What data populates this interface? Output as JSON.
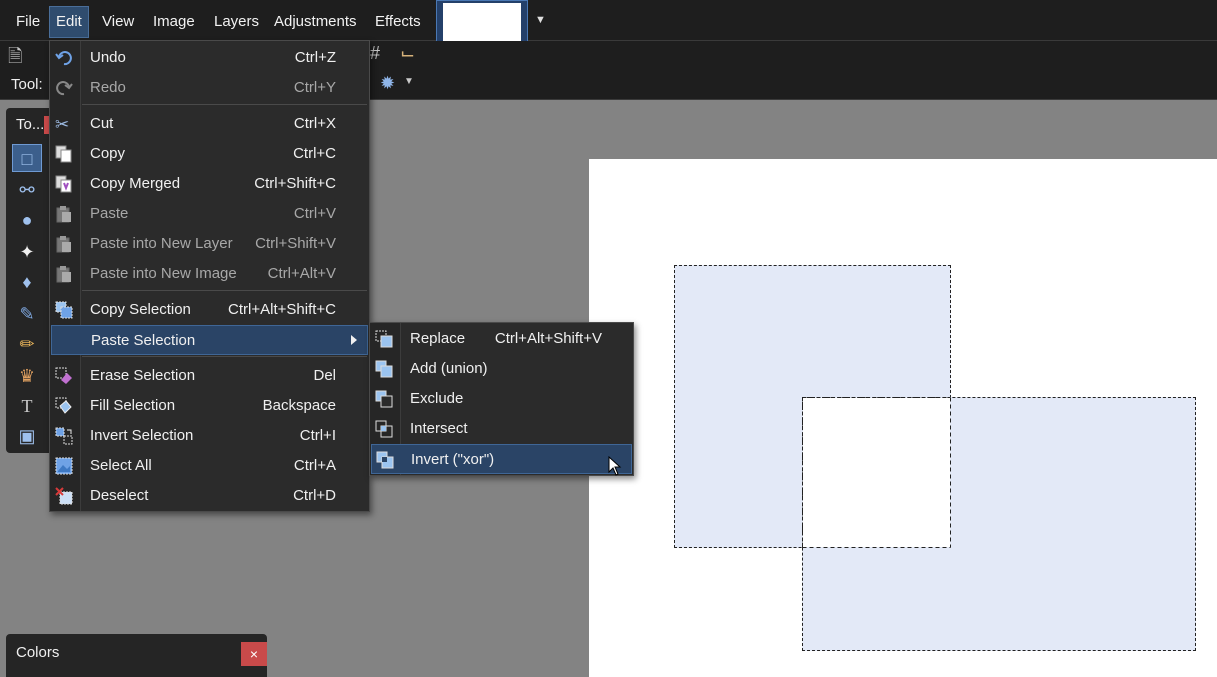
{
  "menubar": {
    "items": [
      "File",
      "Edit",
      "View",
      "Image",
      "Layers",
      "Adjustments",
      "Effects"
    ],
    "active": "Edit"
  },
  "toolbar": {
    "tool_label": "Tool:"
  },
  "tools_panel": {
    "title": "To..."
  },
  "colors_panel": {
    "title": "Colors",
    "close": "×"
  },
  "edit_menu": {
    "items": [
      {
        "label": "Undo",
        "shortcut": "Ctrl+Z",
        "icon": "undo-icon"
      },
      {
        "label": "Redo",
        "shortcut": "Ctrl+Y",
        "icon": "redo-icon"
      },
      {
        "label": "Cut",
        "shortcut": "Ctrl+X",
        "icon": "scissors-icon"
      },
      {
        "label": "Copy",
        "shortcut": "Ctrl+C",
        "icon": "copy-icon"
      },
      {
        "label": "Copy Merged",
        "shortcut": "Ctrl+Shift+C",
        "icon": "copy-merged-icon"
      },
      {
        "label": "Paste",
        "shortcut": "Ctrl+V",
        "icon": "paste-icon"
      },
      {
        "label": "Paste into New Layer",
        "shortcut": "Ctrl+Shift+V",
        "icon": "paste-layer-icon"
      },
      {
        "label": "Paste into New Image",
        "shortcut": "Ctrl+Alt+V",
        "icon": "paste-image-icon"
      },
      {
        "label": "Copy Selection",
        "shortcut": "Ctrl+Alt+Shift+C",
        "icon": "copy-selection-icon"
      },
      {
        "label": "Paste Selection",
        "shortcut": "",
        "icon": "paste-selection-icon"
      },
      {
        "label": "Erase Selection",
        "shortcut": "Del",
        "icon": "eraser-icon"
      },
      {
        "label": "Fill Selection",
        "shortcut": "Backspace",
        "icon": "fill-bucket-icon"
      },
      {
        "label": "Invert Selection",
        "shortcut": "Ctrl+I",
        "icon": "invert-selection-icon"
      },
      {
        "label": "Select All",
        "shortcut": "Ctrl+A",
        "icon": "select-all-icon"
      },
      {
        "label": "Deselect",
        "shortcut": "Ctrl+D",
        "icon": "deselect-icon"
      }
    ]
  },
  "paste_selection_submenu": {
    "items": [
      {
        "label": "Replace",
        "shortcut": "Ctrl+Alt+Shift+V",
        "icon": "replace-icon"
      },
      {
        "label": "Add (union)",
        "shortcut": "",
        "icon": "union-icon"
      },
      {
        "label": "Exclude",
        "shortcut": "",
        "icon": "exclude-icon"
      },
      {
        "label": "Intersect",
        "shortcut": "",
        "icon": "intersect-icon"
      },
      {
        "label": "Invert (\"xor\")",
        "shortcut": "",
        "icon": "xor-icon"
      }
    ]
  },
  "colors": {
    "accent": "#2a4466",
    "menu_bg": "#2b2b2b",
    "selection_fill": "#e3e9f7",
    "close_red": "#c94a4a"
  }
}
